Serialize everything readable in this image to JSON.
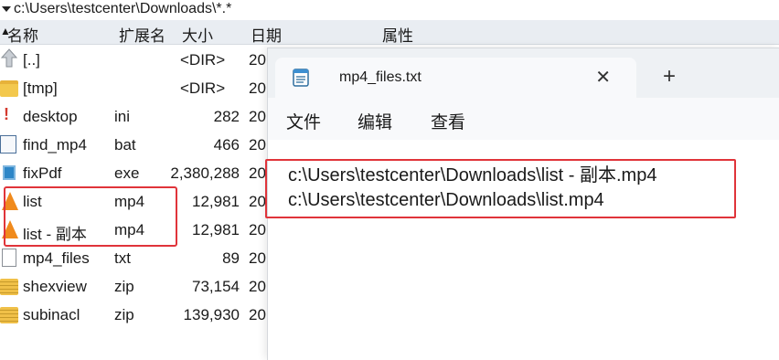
{
  "path_bar": {
    "path": "c:\\Users\\testcenter\\Downloads\\*.*"
  },
  "columns": {
    "name": "名称",
    "ext": "扩展名",
    "size": "大小",
    "date": "日期",
    "attr": "属性"
  },
  "files": [
    {
      "icon": "up-icon",
      "name": "[..]",
      "ext": "",
      "size": "<DIR>",
      "date": "20"
    },
    {
      "icon": "folder-icon",
      "name": "[tmp]",
      "ext": "",
      "size": "<DIR>",
      "date": "20"
    },
    {
      "icon": "warning-icon",
      "name": "desktop",
      "ext": "ini",
      "size": "282",
      "date": "20"
    },
    {
      "icon": "batch-file-icon",
      "name": "find_mp4",
      "ext": "bat",
      "size": "466",
      "date": "20"
    },
    {
      "icon": "exe-icon",
      "name": "fixPdf",
      "ext": "exe",
      "size": "2,380,288",
      "date": "20"
    },
    {
      "icon": "vlc-icon",
      "name": "list",
      "ext": "mp4",
      "size": "12,981",
      "date": "20"
    },
    {
      "icon": "vlc-icon",
      "name": "list - 副本",
      "ext": "mp4",
      "size": "12,981",
      "date": "20"
    },
    {
      "icon": "text-file-icon",
      "name": "mp4_files",
      "ext": "txt",
      "size": "89",
      "date": "20"
    },
    {
      "icon": "zip-icon",
      "name": "shexview",
      "ext": "zip",
      "size": "73,154",
      "date": "20"
    },
    {
      "icon": "zip-icon",
      "name": "subinacl",
      "ext": "zip",
      "size": "139,930",
      "date": "20"
    }
  ],
  "notepad": {
    "tab_title": "mp4_files.txt",
    "close_glyph": "✕",
    "new_tab_glyph": "+",
    "menu": {
      "file": "文件",
      "edit": "编辑",
      "view": "查看"
    },
    "lines": [
      "c:\\Users\\testcenter\\Downloads\\list - 副本.mp4",
      "c:\\Users\\testcenter\\Downloads\\list.mp4"
    ]
  },
  "colors": {
    "highlight": "#e0343a",
    "header_bg": "#e9edf2",
    "vlc_orange": "#f08a1c"
  }
}
